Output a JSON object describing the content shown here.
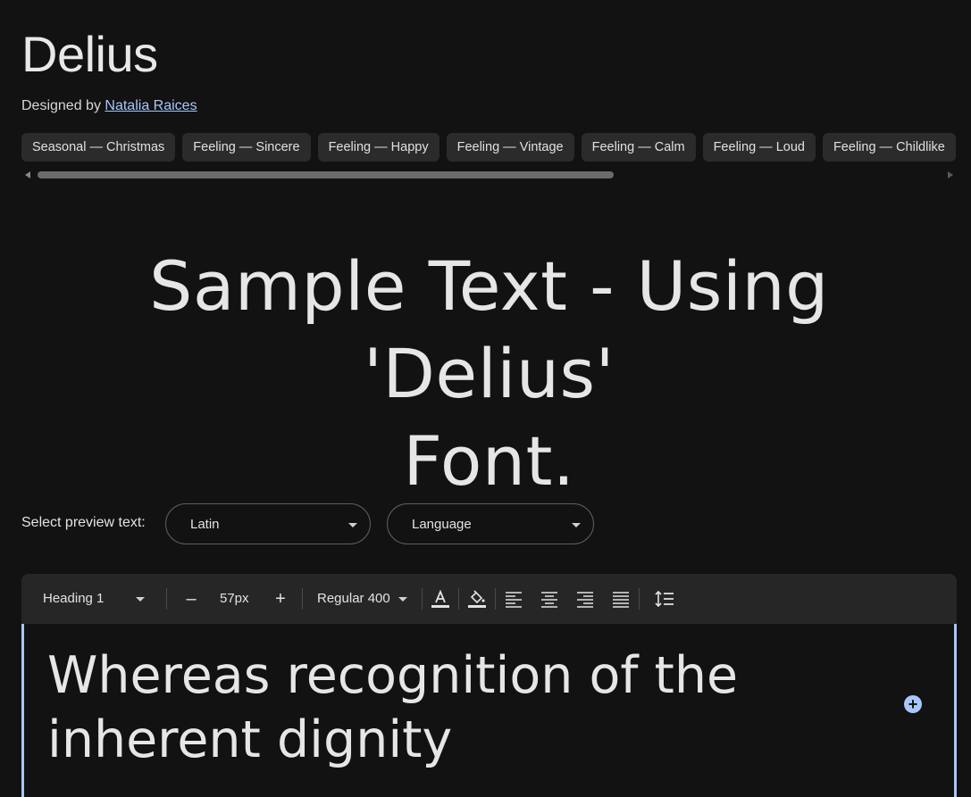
{
  "font": {
    "name": "Delius",
    "designed_by_label": "Designed by",
    "designer": "Natalia Raices"
  },
  "tags": [
    "Seasonal — Christmas",
    "Feeling — Sincere",
    "Feeling — Happy",
    "Feeling — Vintage",
    "Feeling — Calm",
    "Feeling — Loud",
    "Feeling — Childlike"
  ],
  "sample": {
    "line1": "Sample Text - Using 'Delius'",
    "line2": "Font."
  },
  "preview": {
    "label": "Select preview text:",
    "script_value": "Latin",
    "language_value": "Language"
  },
  "toolbar": {
    "style_value": "Heading 1",
    "decrease_label": "–",
    "size_value": "57px",
    "increase_label": "+",
    "weight_value": "Regular 400",
    "icons": [
      "text-color-icon",
      "highlight-color-icon",
      "align-left-icon",
      "align-center-icon",
      "align-right-icon",
      "align-justify-icon",
      "line-height-icon"
    ]
  },
  "editor": {
    "text": "Whereas recognition of the inherent dignity",
    "add_label": "+"
  },
  "colors": {
    "background": "#121212",
    "chip": "#2b2b2b",
    "link": "#a8c7fa",
    "accent": "#a8c7fa",
    "toolbar": "#262626"
  }
}
